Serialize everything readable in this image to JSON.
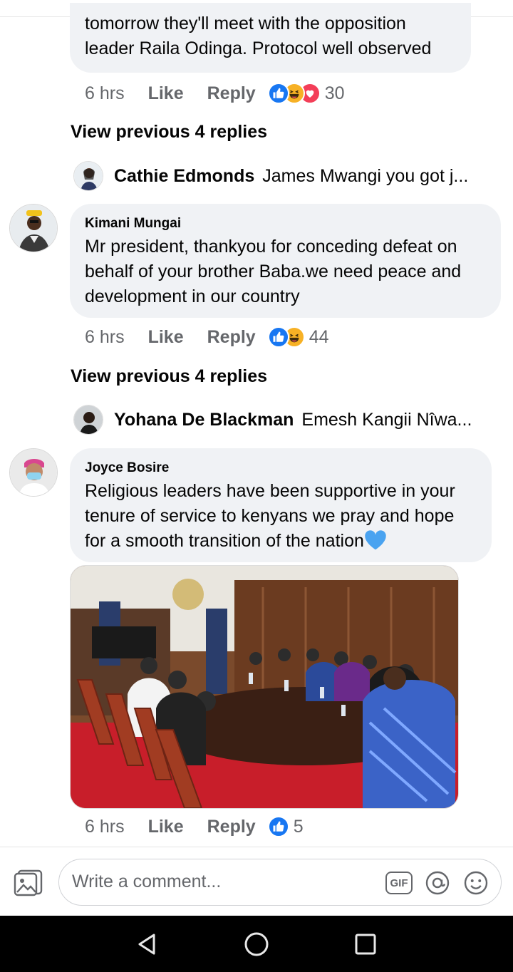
{
  "colors": {
    "reaction_like": "#1877f2",
    "reaction_haha": "#f7b125",
    "reaction_love": "#f33e58",
    "bubble": "#f0f2f5",
    "muted": "#65676b"
  },
  "comment_top": {
    "text": "tomorrow they'll meet with the opposition leader Raila Odinga. Protocol well observed",
    "time": "6 hrs",
    "like_label": "Like",
    "reply_label": "Reply",
    "reaction_count": "30",
    "reactions": [
      "like-icon",
      "haha-icon",
      "love-icon"
    ],
    "view_previous": "View previous 4 replies",
    "latest_reply": {
      "name": "Cathie Edmonds",
      "text": "James Mwangi you got j..."
    }
  },
  "comment_kimani": {
    "author": "Kimani Mungai",
    "text": "Mr president, thankyou for conceding defeat on behalf of your brother Baba.we need peace and development in our country",
    "time": "6 hrs",
    "like_label": "Like",
    "reply_label": "Reply",
    "reaction_count": "44",
    "reactions": [
      "like-icon",
      "haha-icon"
    ],
    "view_previous": "View previous 4 replies",
    "latest_reply": {
      "name": "Yohana De Blackman",
      "text": "Emesh Kangii Nîwa..."
    }
  },
  "comment_joyce": {
    "author": "Joyce Bosire",
    "text": "Religious leaders have been supportive in your tenure of service to kenyans we pray and hope for a smooth transition of the nation",
    "emoji": "blue-heart-icon",
    "time": "6 hrs",
    "like_label": "Like",
    "reply_label": "Reply",
    "reaction_count": "5",
    "reactions": [
      "like-icon"
    ]
  },
  "composer": {
    "placeholder": "Write a comment...",
    "gif_label": "GIF"
  }
}
